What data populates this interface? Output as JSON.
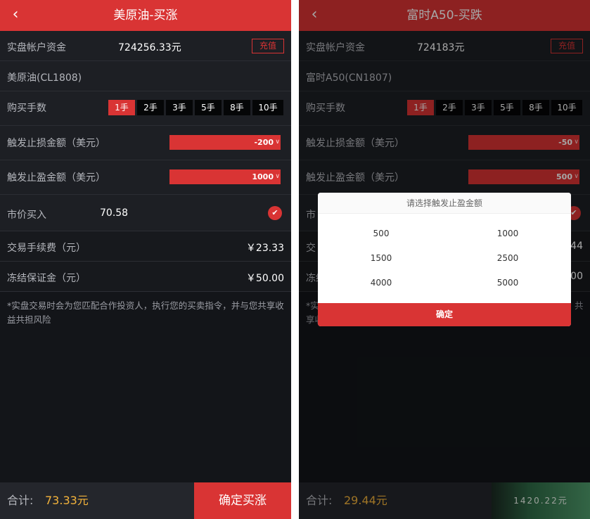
{
  "left": {
    "title": "美原油-买涨",
    "back_icon": "‹",
    "account_label": "实盘帐户资金",
    "account_value": "724256.33元",
    "recharge_label": "充值",
    "contract": "美原油(CL1808)",
    "lots_label": "购买手数",
    "lots": [
      "1手",
      "2手",
      "3手",
      "5手",
      "8手",
      "10手"
    ],
    "lots_selected": 0,
    "stop_loss_label": "触发止损金额（美元）",
    "stop_loss_value": "-200",
    "take_profit_label": "触发止盈金额（美元）",
    "take_profit_value": "1000",
    "market_buy_label": "市价买入",
    "market_buy_value": "70.58",
    "fee_label": "交易手续费（元）",
    "fee_value": "￥23.33",
    "margin_label": "冻结保证金（元）",
    "margin_value": "￥50.00",
    "note_text": "*实盘交易时会为您匹配合作投资人，执行您的买卖指令，并与您共享收益共担风险",
    "total_label": "合计:",
    "total_value": "73.33元",
    "confirm_label": "确定买涨"
  },
  "right": {
    "title": "富时A50-买跌",
    "back_icon": "‹",
    "account_label": "实盘帐户资金",
    "account_value": "724183元",
    "recharge_label": "充值",
    "contract": "富时A50(CN1807)",
    "lots_label": "购买手数",
    "lots": [
      "1手",
      "2手",
      "3手",
      "5手",
      "8手",
      "10手"
    ],
    "lots_selected": 0,
    "stop_loss_label": "触发止损金额（美元）",
    "stop_loss_value": "-50",
    "take_profit_label": "触发止盈金额（美元）",
    "take_profit_value": "500",
    "market_buy_label_partial": "市",
    "fee_label_partial": "交",
    "fee_value_partial": "44",
    "margin_label_partial": "冻结",
    "margin_value_partial": "00",
    "note_partial_left": "*实",
    "note_partial_left2": "享收",
    "note_partial_right": "共",
    "total_label": "合计:",
    "total_value": "29.44元",
    "watermark_text": "1420.22元",
    "dialog": {
      "title": "请选择触发止盈金额",
      "options": [
        "500",
        "1000",
        "1500",
        "2500",
        "4000",
        "5000"
      ],
      "confirm_label": "确定"
    }
  },
  "colors": {
    "accent": "#d93434",
    "background": "#131519",
    "row": "#1d1f24",
    "total": "#f3b33b"
  }
}
